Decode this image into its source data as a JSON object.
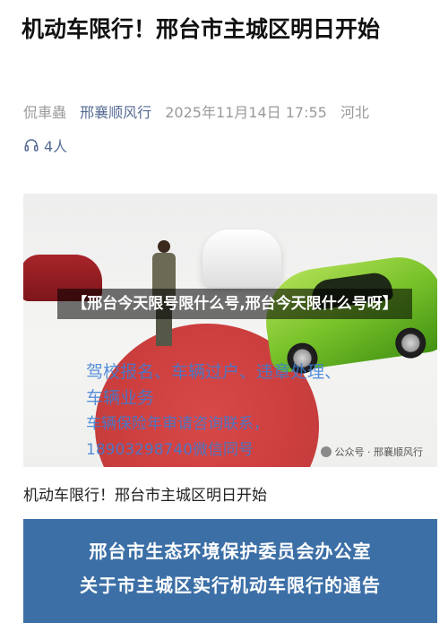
{
  "article": {
    "title": "机动车限行！邢台市主城区明日开始",
    "meta": {
      "author": "侃車蟲",
      "account": "邢襄顺风行",
      "date": "2025年11月14日 17:55",
      "location": "河北"
    },
    "listen": {
      "icon": "headphones-icon",
      "count": "4人"
    }
  },
  "cover": {
    "caption": "【邢台今天限号限什么号,邢台今天限什么号呀】",
    "watermark_line1": "驾校报名、车辆过户、违章处理、车辆业务",
    "watermark_line2": "车辆保险年审请咨询联系，",
    "watermark_line3": "18903298740微信同号",
    "brand": "公众号 · 邢襄顺风行"
  },
  "body": {
    "subtitle": "机动车限行！邢台市主城区明日开始"
  },
  "notice": {
    "line1": "邢台市生态环境保护委员会办公室",
    "line2": "关于市主城区实行机动车限行的通告"
  },
  "colors": {
    "link": "#576b95",
    "notice_bg": "#3c6fa6"
  }
}
